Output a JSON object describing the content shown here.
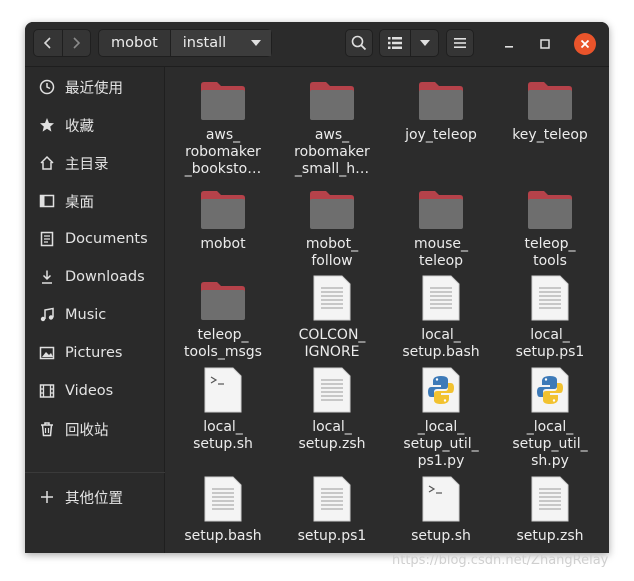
{
  "header": {
    "path": [
      "mobot",
      "install"
    ]
  },
  "sidebar": {
    "items": [
      {
        "label": "最近使用",
        "icon": "clock-icon"
      },
      {
        "label": "收藏",
        "icon": "star-icon"
      },
      {
        "label": "主目录",
        "icon": "home-icon"
      },
      {
        "label": "桌面",
        "icon": "desktop-icon"
      },
      {
        "label": "Documents",
        "icon": "document-icon"
      },
      {
        "label": "Downloads",
        "icon": "download-icon"
      },
      {
        "label": "Music",
        "icon": "music-icon"
      },
      {
        "label": "Pictures",
        "icon": "picture-icon"
      },
      {
        "label": "Videos",
        "icon": "film-icon"
      },
      {
        "label": "回收站",
        "icon": "trash-icon"
      },
      {
        "label": "其他位置",
        "icon": "plus-icon"
      }
    ]
  },
  "files": [
    {
      "label": "aws_\nrobomaker\n_booksto…",
      "type": "folder"
    },
    {
      "label": "aws_\nrobomaker\n_small_h…",
      "type": "folder"
    },
    {
      "label": "joy_teleop",
      "type": "folder"
    },
    {
      "label": "key_teleop",
      "type": "folder"
    },
    {
      "label": "mobot",
      "type": "folder"
    },
    {
      "label": "mobot_\nfollow",
      "type": "folder"
    },
    {
      "label": "mouse_\nteleop",
      "type": "folder"
    },
    {
      "label": "teleop_\ntools",
      "type": "folder"
    },
    {
      "label": "teleop_\ntools_msgs",
      "type": "folder"
    },
    {
      "label": "COLCON_\nIGNORE",
      "type": "text"
    },
    {
      "label": "local_\nsetup.bash",
      "type": "text"
    },
    {
      "label": "local_\nsetup.ps1",
      "type": "text"
    },
    {
      "label": "local_\nsetup.sh",
      "type": "script"
    },
    {
      "label": "local_\nsetup.zsh",
      "type": "text"
    },
    {
      "label": "_local_\nsetup_util_\nps1.py",
      "type": "python"
    },
    {
      "label": "_local_\nsetup_util_\nsh.py",
      "type": "python"
    },
    {
      "label": "setup.bash",
      "type": "text"
    },
    {
      "label": "setup.ps1",
      "type": "text"
    },
    {
      "label": "setup.sh",
      "type": "script"
    },
    {
      "label": "setup.zsh",
      "type": "text"
    }
  ],
  "colors": {
    "window_bg": "#2c2c2c",
    "folder_tab": "#b5424a",
    "folder_body": "#6e6e6e",
    "close_button": "#e9542b"
  },
  "watermark": "https://blog.csdn.net/ZhangRelay"
}
